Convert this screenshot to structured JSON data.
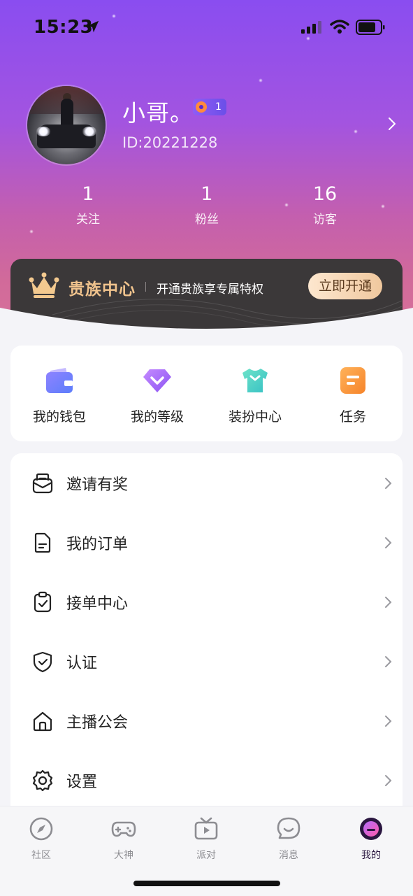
{
  "status_bar": {
    "time": "15:23"
  },
  "profile": {
    "nickname": "小哥。",
    "level": "1",
    "user_id": "ID:20221228"
  },
  "stats": [
    {
      "value": "1",
      "label": "关注"
    },
    {
      "value": "1",
      "label": "粉丝"
    },
    {
      "value": "16",
      "label": "访客"
    }
  ],
  "vip_banner": {
    "title": "贵族中心",
    "subtitle": "开通贵族享专属特权",
    "button": "立即开通",
    "accent_color": "#f0c38d"
  },
  "quick_actions": [
    {
      "label": "我的钱包",
      "icon": "wallet-icon"
    },
    {
      "label": "我的等级",
      "icon": "diamond-icon"
    },
    {
      "label": "装扮中心",
      "icon": "tshirt-icon"
    },
    {
      "label": "任务",
      "icon": "task-icon"
    }
  ],
  "menu": [
    {
      "label": "邀请有奖",
      "icon": "invite-envelope-icon"
    },
    {
      "label": "我的订单",
      "icon": "order-document-icon"
    },
    {
      "label": "接单中心",
      "icon": "clipboard-check-icon"
    },
    {
      "label": "认证",
      "icon": "shield-check-icon"
    },
    {
      "label": "主播公会",
      "icon": "home-icon"
    },
    {
      "label": "设置",
      "icon": "gear-icon"
    }
  ],
  "tab_bar": {
    "active_index": 4,
    "tabs": [
      {
        "label": "社区",
        "icon": "compass-icon"
      },
      {
        "label": "大神",
        "icon": "gamepad-icon"
      },
      {
        "label": "派对",
        "icon": "tv-icon"
      },
      {
        "label": "消息",
        "icon": "chat-bubble-icon"
      },
      {
        "label": "我的",
        "icon": "profile-avatar-icon"
      }
    ]
  },
  "colors": {
    "hero_top": "#8a4df0",
    "hero_bottom": "#d9739b",
    "active_tab": "#2a1640"
  }
}
